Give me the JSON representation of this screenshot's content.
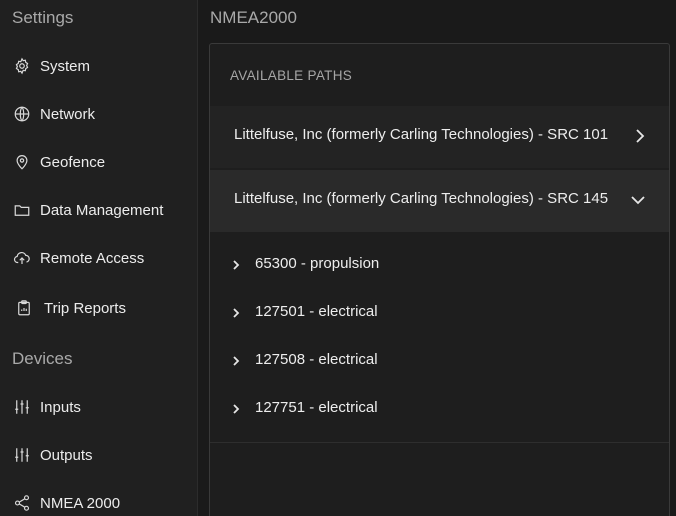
{
  "sidebar": {
    "settings_header": "Settings",
    "devices_header": "Devices",
    "settings_items": [
      {
        "label": "System",
        "icon": "gear-icon"
      },
      {
        "label": "Network",
        "icon": "globe-icon"
      },
      {
        "label": "Geofence",
        "icon": "location-pin-icon"
      },
      {
        "label": "Data Management",
        "icon": "folder-icon"
      },
      {
        "label": "Remote Access",
        "icon": "cloud-upload-icon"
      },
      {
        "label": "Trip Reports",
        "icon": "clipboard-icon"
      }
    ],
    "device_items": [
      {
        "label": "Inputs",
        "icon": "sliders-icon"
      },
      {
        "label": "Outputs",
        "icon": "sliders-icon"
      },
      {
        "label": "NMEA 2000",
        "icon": "share-icon"
      }
    ]
  },
  "main": {
    "title": "NMEA2000",
    "panel_header": "AVAILABLE PATHS",
    "paths": [
      {
        "label": "Littelfuse, Inc (formerly Carling Technologies) - SRC 101",
        "expanded": false
      },
      {
        "label": "Littelfuse, Inc (formerly Carling Technologies) - SRC 145",
        "expanded": true
      }
    ],
    "sub_paths": [
      {
        "label": "65300 - propulsion"
      },
      {
        "label": "127501 - electrical"
      },
      {
        "label": "127508 - electrical"
      },
      {
        "label": "127751 - electrical"
      }
    ]
  },
  "colors": {
    "background": "#1a1a1a",
    "sidebar": "#202020",
    "panel": "#1e1e1e",
    "path_row": "#232323",
    "expanded_row": "#2a2a2a",
    "text": "#ececec",
    "muted": "#a9a9a9"
  }
}
